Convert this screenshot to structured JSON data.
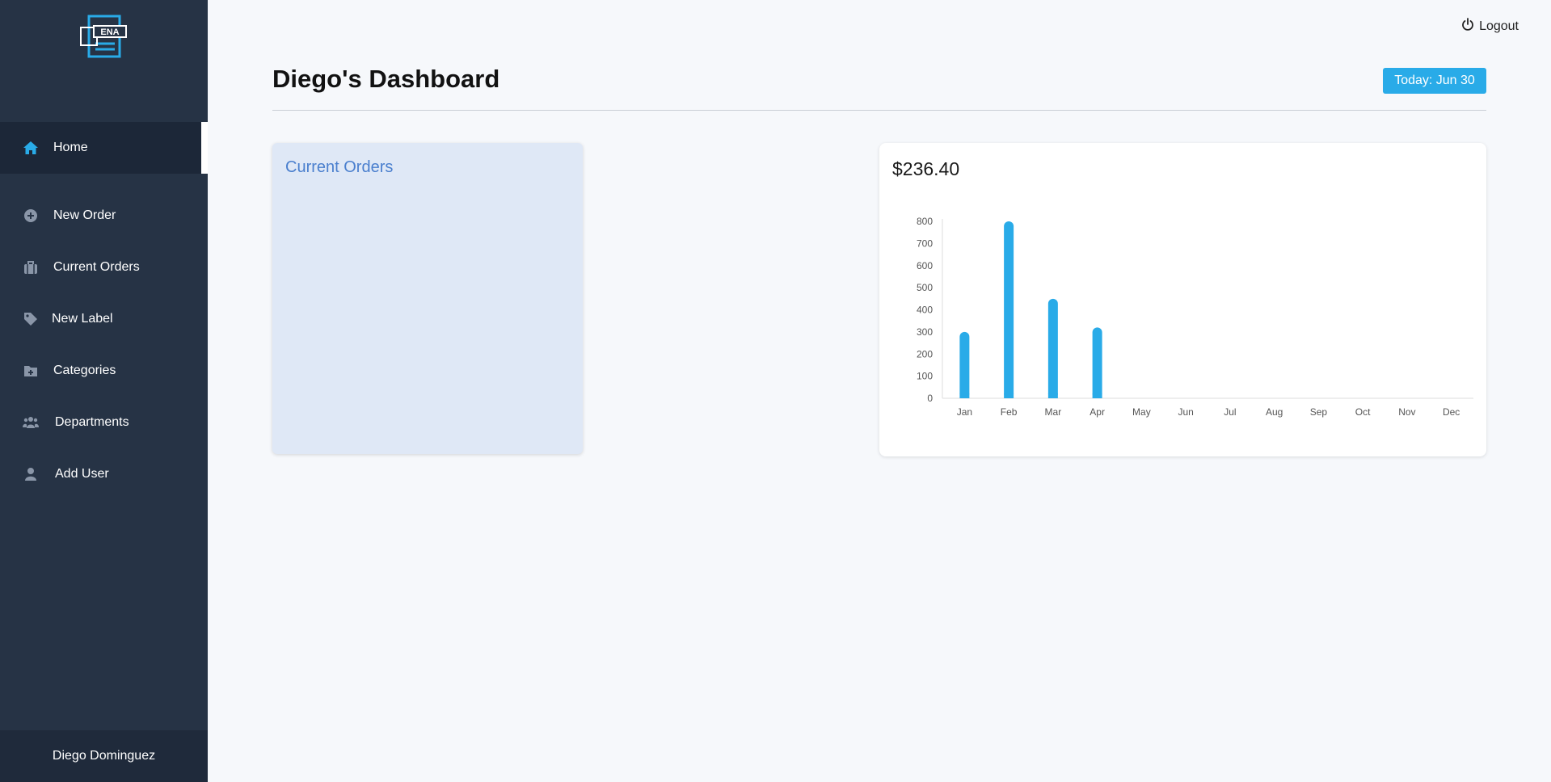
{
  "sidebar": {
    "logo_text": "ENA",
    "items": [
      {
        "label": "Home",
        "icon": "home-icon",
        "active": true
      },
      {
        "label": "New Order",
        "icon": "plus-circle-icon",
        "active": false
      },
      {
        "label": "Current Orders",
        "icon": "briefcase-icon",
        "active": false
      },
      {
        "label": "New Label",
        "icon": "tag-icon",
        "active": false
      },
      {
        "label": "Categories",
        "icon": "folder-plus-icon",
        "active": false
      },
      {
        "label": "Departments",
        "icon": "users-icon",
        "active": false
      },
      {
        "label": "Add User",
        "icon": "user-icon",
        "active": false
      }
    ],
    "user_name": "Diego Dominguez"
  },
  "header": {
    "logout_label": "Logout",
    "title": "Diego's Dashboard",
    "today_label": "Today: Jun 30"
  },
  "orders_card": {
    "title": "Current Orders"
  },
  "revenue_card": {
    "amount": "$236.40"
  },
  "colors": {
    "accent": "#29abe8",
    "sidebar_bg": "#263345",
    "orders_card_bg": "#dfe8f6",
    "orders_title": "#4a7fce"
  },
  "chart_data": {
    "type": "bar",
    "categories": [
      "Jan",
      "Feb",
      "Mar",
      "Apr",
      "May",
      "Jun",
      "Jul",
      "Aug",
      "Sep",
      "Oct",
      "Nov",
      "Dec"
    ],
    "values": [
      300,
      800,
      450,
      320,
      0,
      0,
      0,
      0,
      0,
      0,
      0,
      0
    ],
    "yticks": [
      0,
      100,
      200,
      300,
      400,
      500,
      600,
      700,
      800
    ],
    "ylim": [
      0,
      800
    ],
    "title": "",
    "xlabel": "",
    "ylabel": "",
    "grid": false,
    "color": "#29abe8"
  }
}
